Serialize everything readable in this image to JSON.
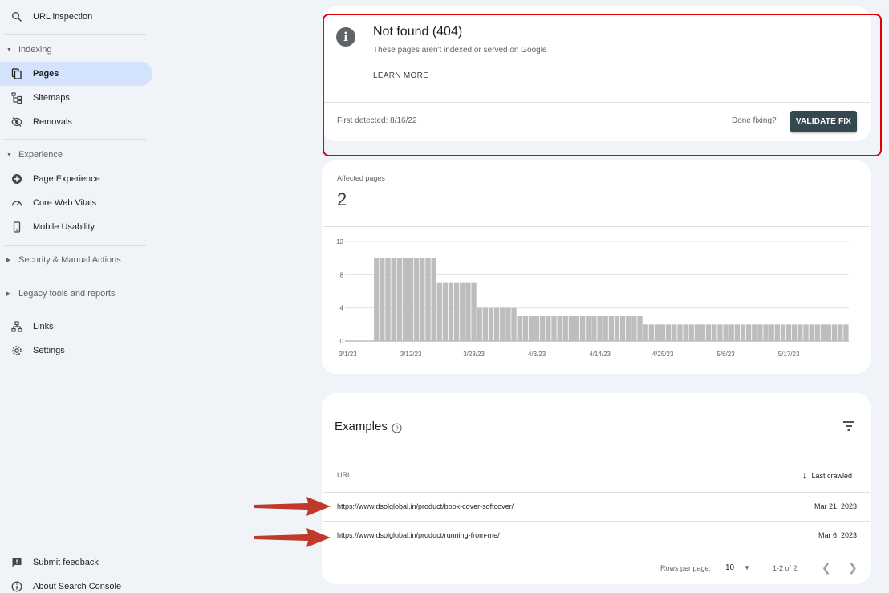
{
  "sidebar": {
    "url_inspection": "URL inspection",
    "indexing": {
      "header": "Indexing",
      "items": [
        {
          "label": "Pages",
          "icon": "pages-icon",
          "active": true
        },
        {
          "label": "Sitemaps",
          "icon": "sitemap-icon"
        },
        {
          "label": "Removals",
          "icon": "removals-icon"
        }
      ]
    },
    "experience": {
      "header": "Experience",
      "items": [
        {
          "label": "Page Experience",
          "icon": "page-experience-icon"
        },
        {
          "label": "Core Web Vitals",
          "icon": "speedometer-icon"
        },
        {
          "label": "Mobile Usability",
          "icon": "phone-icon"
        }
      ]
    },
    "security": "Security & Manual Actions",
    "legacy": "Legacy tools and reports",
    "links": "Links",
    "settings": "Settings",
    "submit_feedback": "Submit feedback",
    "about": "About Search Console"
  },
  "issue": {
    "title": "Not found (404)",
    "description": "These pages aren't indexed or served on Google",
    "learn_more": "LEARN MORE",
    "first_detected": "First detected: 8/16/22",
    "done_fixing": "Done fixing?",
    "validate_fix": "VALIDATE FIX"
  },
  "affected": {
    "label": "Affected pages",
    "value": "2"
  },
  "chart_data": {
    "type": "bar",
    "title": "",
    "xlabel": "",
    "ylabel": "",
    "ylim": [
      0,
      12
    ],
    "y_ticks": [
      0,
      4,
      8,
      12
    ],
    "x_tick_labels": [
      "3/1/23",
      "3/12/23",
      "3/23/23",
      "4/3/23",
      "4/14/23",
      "4/25/23",
      "5/6/23",
      "5/17/23"
    ],
    "x_tick_indices": [
      0,
      11,
      22,
      33,
      44,
      55,
      66,
      77
    ],
    "categories": [
      "3/1/23",
      "3/2/23",
      "3/3/23",
      "3/4/23",
      "3/5/23",
      "3/6/23",
      "3/7/23",
      "3/8/23",
      "3/9/23",
      "3/10/23",
      "3/11/23",
      "3/12/23",
      "3/13/23",
      "3/14/23",
      "3/15/23",
      "3/16/23",
      "3/17/23",
      "3/18/23",
      "3/19/23",
      "3/20/23",
      "3/21/23",
      "3/22/23",
      "3/23/23",
      "3/24/23",
      "3/25/23",
      "3/26/23",
      "3/27/23",
      "3/28/23",
      "3/29/23",
      "3/30/23",
      "3/31/23",
      "4/1/23",
      "4/2/23",
      "4/3/23",
      "4/4/23",
      "4/5/23",
      "4/6/23",
      "4/7/23",
      "4/8/23",
      "4/9/23",
      "4/10/23",
      "4/11/23",
      "4/12/23",
      "4/13/23",
      "4/14/23",
      "4/15/23",
      "4/16/23",
      "4/17/23",
      "4/18/23",
      "4/19/23",
      "4/20/23",
      "4/21/23",
      "4/22/23",
      "4/23/23",
      "4/24/23",
      "4/25/23",
      "4/26/23",
      "4/27/23",
      "4/28/23",
      "4/29/23",
      "4/30/23",
      "5/1/23",
      "5/2/23",
      "5/3/23",
      "5/4/23",
      "5/5/23",
      "5/6/23",
      "5/7/23",
      "5/8/23",
      "5/9/23",
      "5/10/23",
      "5/11/23",
      "5/12/23",
      "5/13/23",
      "5/14/23",
      "5/15/23",
      "5/16/23",
      "5/17/23",
      "5/18/23",
      "5/19/23",
      "5/20/23",
      "5/21/23",
      "5/22/23",
      "5/23/23",
      "5/24/23",
      "5/25/23",
      "5/26/23",
      "5/27/23"
    ],
    "values": [
      0,
      0,
      0,
      0,
      0,
      10,
      10,
      10,
      10,
      10,
      10,
      10,
      10,
      10,
      10,
      10,
      7,
      7,
      7,
      7,
      7,
      7,
      7,
      4,
      4,
      4,
      4,
      4,
      4,
      4,
      3,
      3,
      3,
      3,
      3,
      3,
      3,
      3,
      3,
      3,
      3,
      3,
      3,
      3,
      3,
      3,
      3,
      3,
      3,
      3,
      3,
      3,
      2,
      2,
      2,
      2,
      2,
      2,
      2,
      2,
      2,
      2,
      2,
      2,
      2,
      2,
      2,
      2,
      2,
      2,
      2,
      2,
      2,
      2,
      2,
      2,
      2,
      2,
      2,
      2,
      2,
      2,
      2,
      2,
      2,
      2,
      2,
      2
    ],
    "bar_color": "#bdbdbd",
    "grid": true
  },
  "examples": {
    "title": "Examples",
    "col_url": "URL",
    "col_last_crawled": "Last crawled",
    "rows": [
      {
        "url": "https://www.dsolglobal.in/product/book-cover-softcover/",
        "date": "Mar 21, 2023"
      },
      {
        "url": "https://www.dsolglobal.in/product/running-from-me/",
        "date": "Mar 6, 2023"
      }
    ],
    "rows_per_page_label": "Rows per page:",
    "rows_per_page_value": "10",
    "range": "1-2 of 2"
  },
  "colors": {
    "highlight_border": "#e00000",
    "arrow": "#c0392b",
    "button_bg": "#37474f",
    "active_nav": "#d3e3fd"
  }
}
